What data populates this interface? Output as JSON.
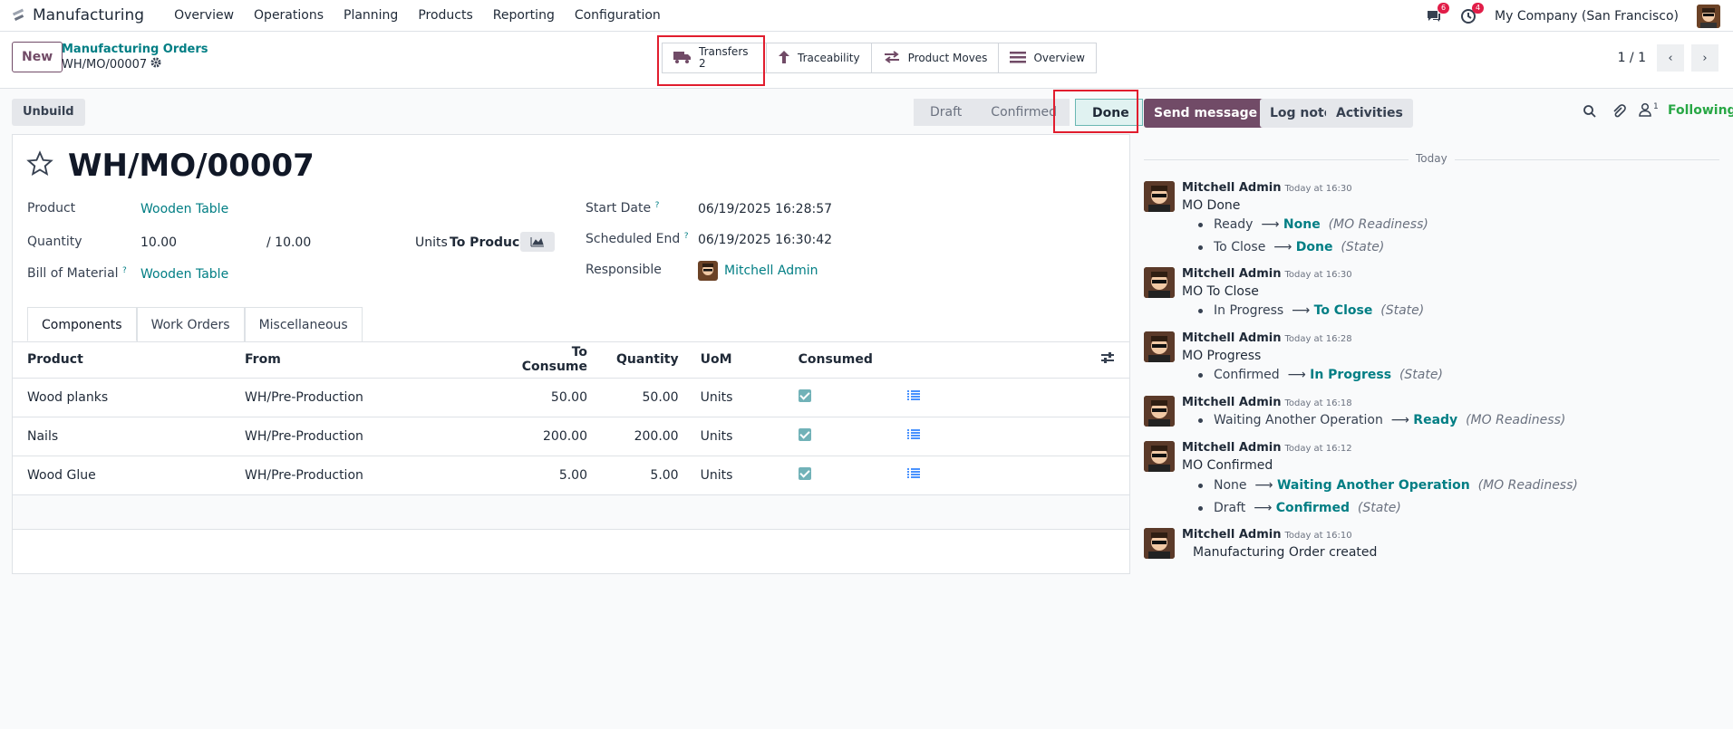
{
  "app": {
    "name": "Manufacturing"
  },
  "menu": [
    "Overview",
    "Operations",
    "Planning",
    "Products",
    "Reporting",
    "Configuration"
  ],
  "topright": {
    "chat_count": "6",
    "activity_count": "4",
    "company": "My Company (San Francisco)"
  },
  "control": {
    "new_label": "New",
    "breadcrumb": "Manufacturing Orders",
    "record": "WH/MO/00007",
    "smart_buttons": {
      "transfers_label": "Transfers",
      "transfers_count": "2",
      "traceability": "Traceability",
      "product_moves": "Product Moves",
      "overview": "Overview"
    },
    "pager": "1 / 1"
  },
  "status": {
    "unbuild": "Unbuild",
    "stages": [
      "Draft",
      "Confirmed",
      "Done"
    ]
  },
  "form": {
    "title": "WH/MO/00007",
    "product_label": "Product",
    "product": "Wooden Table",
    "quantity_label": "Quantity",
    "quantity": "10.00",
    "quantity_total": "/ 10.00",
    "units": "Units",
    "to_produce": "To Produce",
    "bom_label": "Bill of Material",
    "bom": "Wooden Table",
    "start_label": "Start Date",
    "start": "06/19/2025 16:28:57",
    "end_label": "Scheduled End",
    "end": "06/19/2025 16:30:42",
    "resp_label": "Responsible",
    "resp": "Mitchell Admin"
  },
  "tabs": [
    "Components",
    "Work Orders",
    "Miscellaneous"
  ],
  "table": {
    "headers": [
      "Product",
      "From",
      "To Consume",
      "Quantity",
      "UoM",
      "Consumed"
    ],
    "rows": [
      [
        "Wood planks",
        "WH/Pre-Production",
        "50.00",
        "50.00",
        "Units"
      ],
      [
        "Nails",
        "WH/Pre-Production",
        "200.00",
        "200.00",
        "Units"
      ],
      [
        "Wood Glue",
        "WH/Pre-Production",
        "5.00",
        "5.00",
        "Units"
      ]
    ]
  },
  "chatter": {
    "send": "Send message",
    "log": "Log note",
    "activities": "Activities",
    "followers": "1",
    "following": "Following",
    "today": "Today",
    "author": "Mitchell Admin",
    "m1": {
      "time": "Today at 16:30",
      "body": "MO Done",
      "l1a": "Ready",
      "l1b": "None",
      "l1c": "(MO Readiness)",
      "l2a": "To Close",
      "l2b": "Done",
      "l2c": "(State)"
    },
    "m2": {
      "time": "Today at 16:30",
      "body": "MO To Close",
      "l1a": "In Progress",
      "l1b": "To Close",
      "l1c": "(State)"
    },
    "m3": {
      "time": "Today at 16:28",
      "body": "MO Progress",
      "l1a": "Confirmed",
      "l1b": "In Progress",
      "l1c": "(State)"
    },
    "m4": {
      "time": "Today at 16:18",
      "l1a": "Waiting Another Operation",
      "l1b": "Ready",
      "l1c": "(MO Readiness)"
    },
    "m5": {
      "time": "Today at 16:12",
      "body": "MO Confirmed",
      "l1a": "None",
      "l1b": "Waiting Another Operation",
      "l1c": "(MO Readiness)",
      "l2a": "Draft",
      "l2b": "Confirmed",
      "l2c": "(State)"
    },
    "m6": {
      "time": "Today at 16:10",
      "body": "Manufacturing Order created"
    }
  }
}
